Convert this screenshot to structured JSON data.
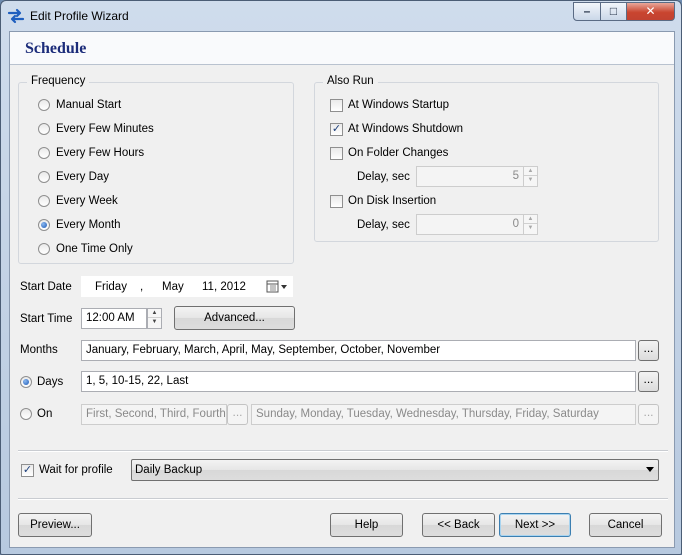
{
  "window": {
    "title": "Edit Profile Wizard",
    "controls": {
      "minimize": "–",
      "maximize": "□",
      "close": "✕"
    }
  },
  "page": {
    "title": "Schedule"
  },
  "frequency": {
    "legend": "Frequency",
    "options": [
      {
        "label": "Manual Start",
        "selected": false
      },
      {
        "label": "Every Few Minutes",
        "selected": false
      },
      {
        "label": "Every Few Hours",
        "selected": false
      },
      {
        "label": "Every Day",
        "selected": false
      },
      {
        "label": "Every Week",
        "selected": false
      },
      {
        "label": "Every Month",
        "selected": true
      },
      {
        "label": "One Time Only",
        "selected": false
      }
    ]
  },
  "also_run": {
    "legend": "Also Run",
    "at_startup": {
      "label": "At Windows Startup",
      "checked": false
    },
    "at_shutdown": {
      "label": "At Windows Shutdown",
      "checked": true
    },
    "folder_changes": {
      "label": "On Folder Changes",
      "checked": false,
      "delay_label": "Delay, sec",
      "delay_value": "5"
    },
    "disk_insertion": {
      "label": "On Disk Insertion",
      "checked": false,
      "delay_label": "Delay, sec",
      "delay_value": "0"
    }
  },
  "start_date": {
    "label": "Start Date",
    "weekday": "Friday",
    "separator": ",",
    "month": "May",
    "day_year": "11, 2012"
  },
  "start_time": {
    "label": "Start Time",
    "value": "12:00 AM",
    "advanced_label": "Advanced..."
  },
  "months": {
    "label": "Months",
    "value": "January, February, March, April, May, September, October, November",
    "browse": "..."
  },
  "days": {
    "label": "Days",
    "selected": true,
    "value": "1, 5, 10-15, 22, Last",
    "browse": "..."
  },
  "on": {
    "label": "On",
    "selected": false,
    "ordinals": "First, Second, Third, Fourth...",
    "weekdays": "Sunday, Monday, Tuesday, Wednesday, Thursday, Friday, Saturday",
    "browse": "..."
  },
  "wait_for_profile": {
    "label": "Wait for profile",
    "checked": true,
    "value": "Daily Backup"
  },
  "footer": {
    "preview": "Preview...",
    "help": "Help",
    "back": "<< Back",
    "next": "Next >>",
    "cancel": "Cancel"
  },
  "icons": {
    "check": "✓",
    "spin_up": "▲",
    "spin_down": "▼",
    "calendar": "calendar-icon"
  },
  "colors": {
    "title_blue": "#1c2c7a",
    "close_red": "#c9452f",
    "radio_blue": "#1b57b5"
  }
}
